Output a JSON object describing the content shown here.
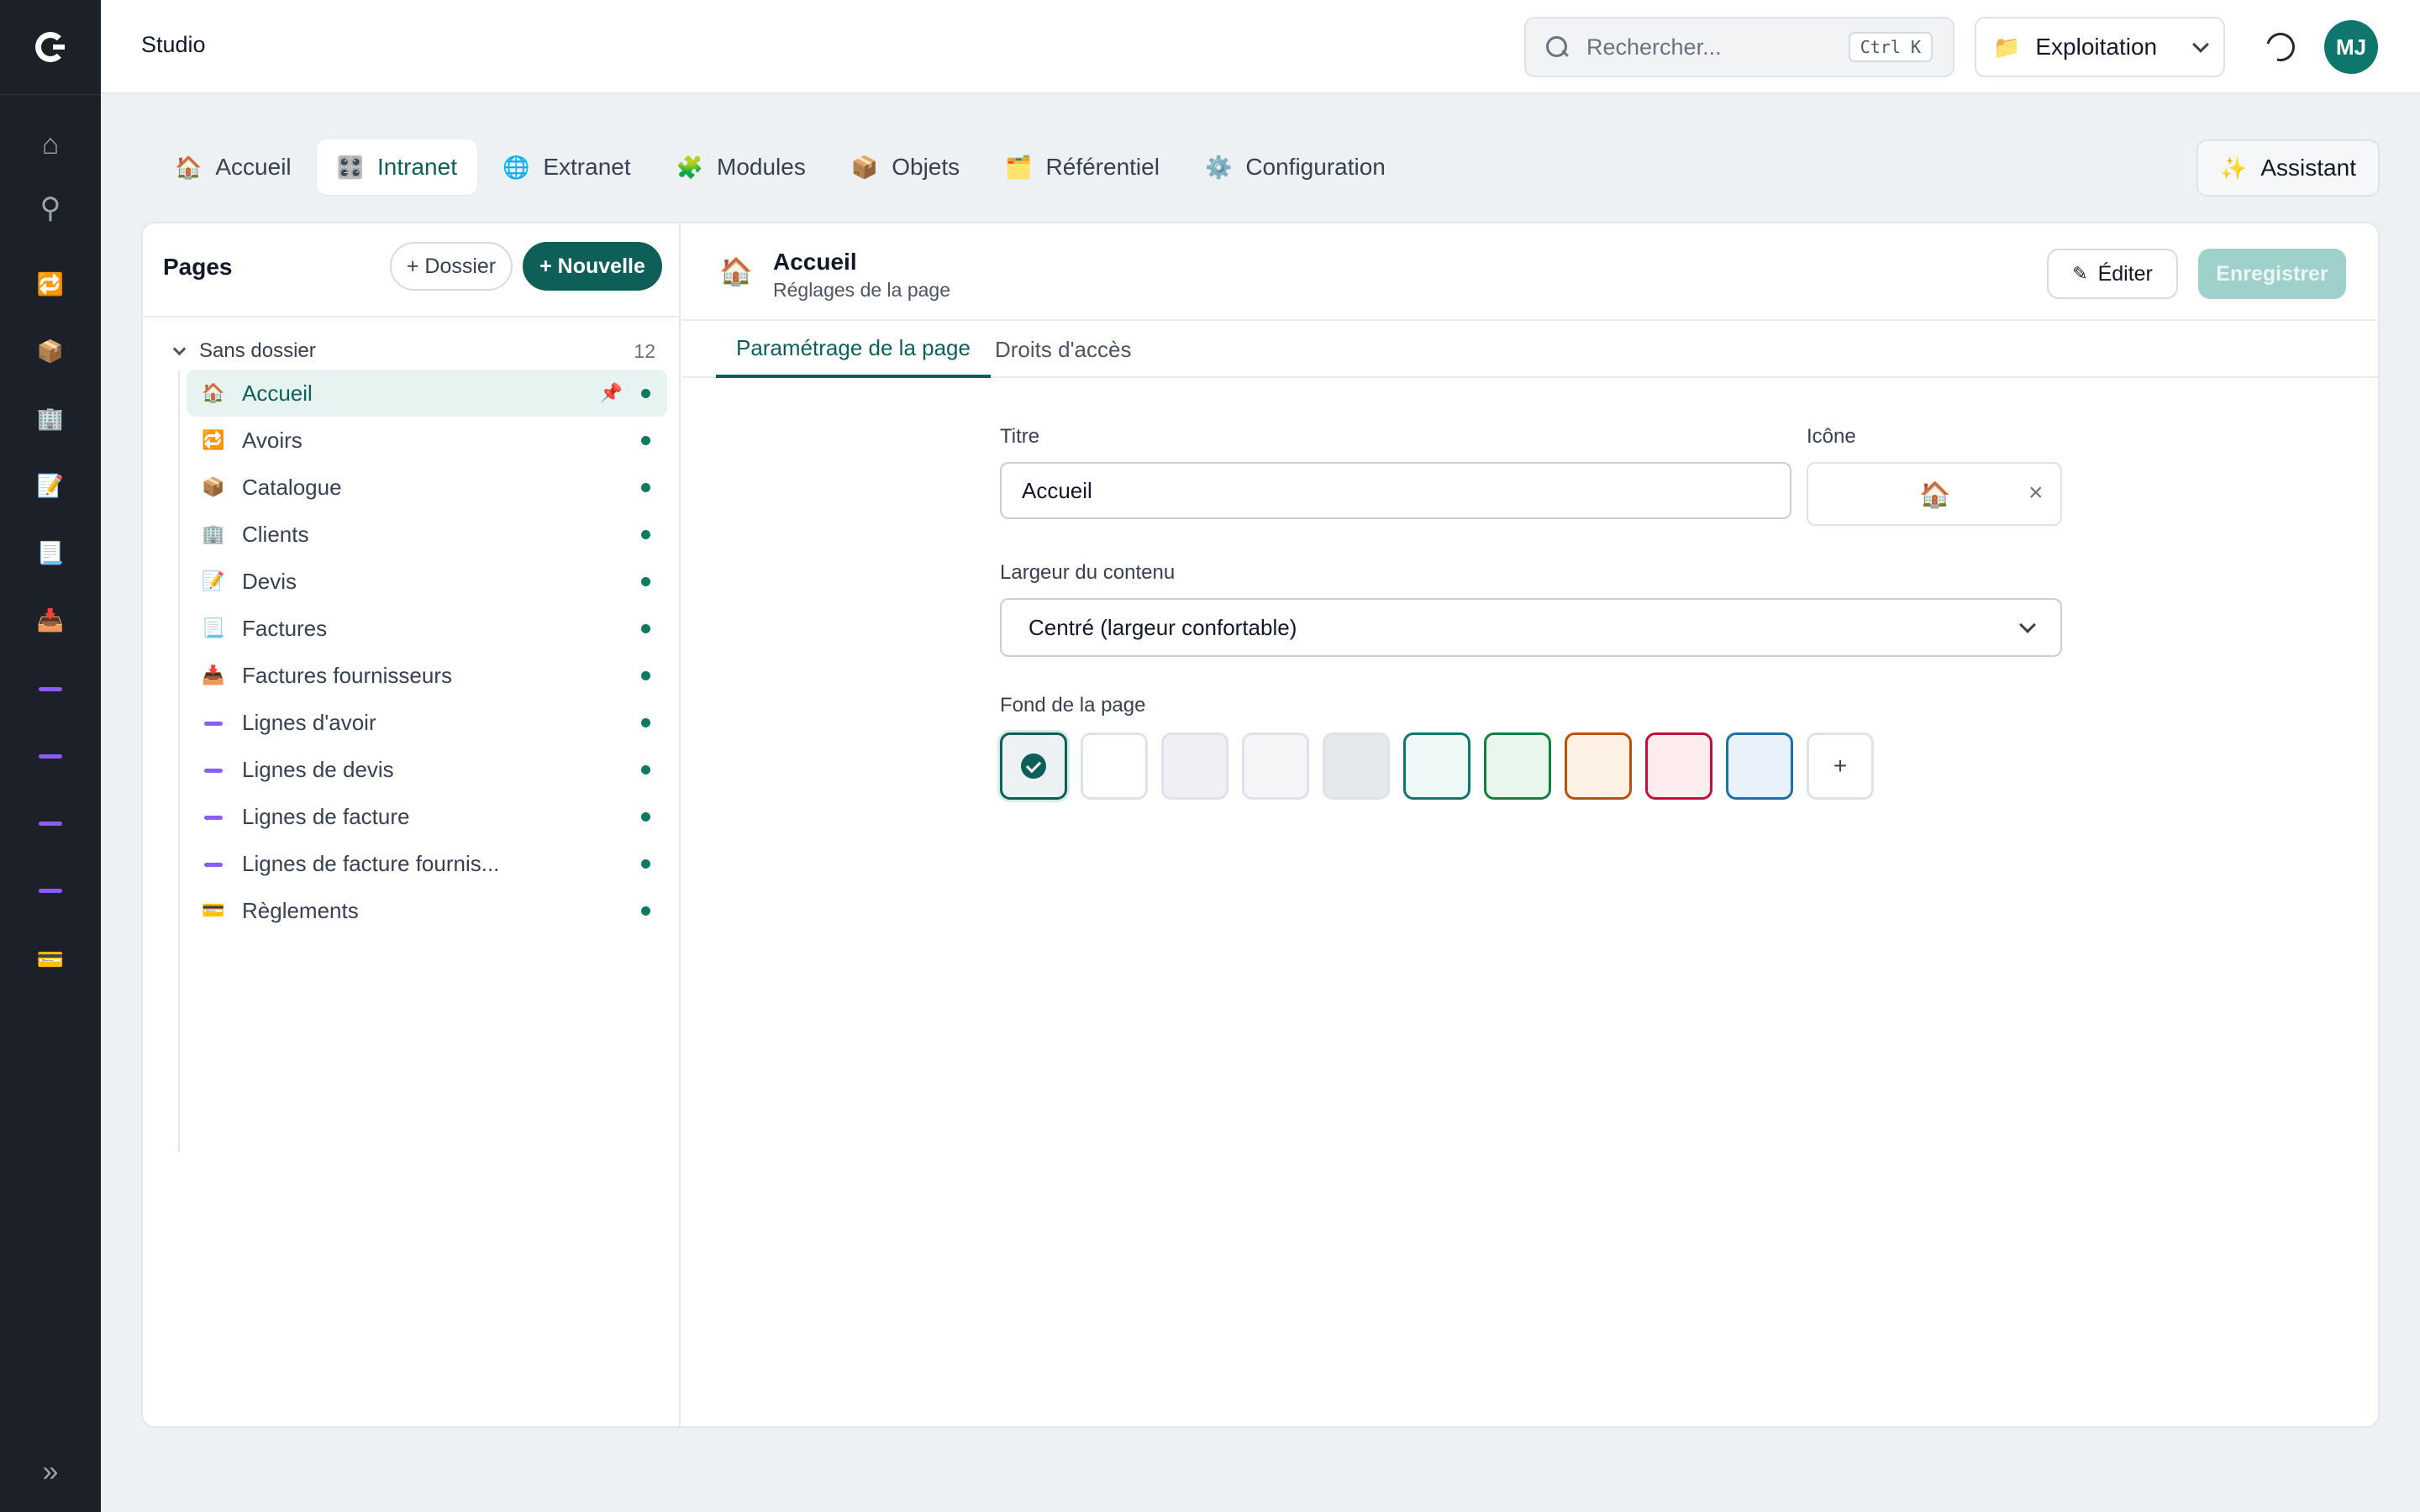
{
  "app": {
    "title": "Studio"
  },
  "rail": {
    "logo": "studio-logo",
    "items": [
      {
        "name": "home",
        "icon": "⌂"
      },
      {
        "name": "search",
        "icon": "⚲"
      },
      {
        "name": "avoirs",
        "icon": "🔁"
      },
      {
        "name": "catalogue",
        "icon": "📦"
      },
      {
        "name": "clients",
        "icon": "🏢"
      },
      {
        "name": "devis",
        "icon": "📝"
      },
      {
        "name": "factures",
        "icon": "📃"
      },
      {
        "name": "factures-fournisseurs",
        "icon": "📥"
      },
      {
        "name": "lignes-avoir",
        "icon": "line"
      },
      {
        "name": "lignes-devis",
        "icon": "line"
      },
      {
        "name": "lignes-facture",
        "icon": "line"
      },
      {
        "name": "lignes-facture-fournisseur",
        "icon": "line"
      },
      {
        "name": "reglements",
        "icon": "💳"
      }
    ],
    "expand_icon": "»"
  },
  "search": {
    "placeholder": "Rechercher...",
    "shortcut": "Ctrl K"
  },
  "workspace": {
    "emoji": "📁",
    "label": "Exploitation"
  },
  "user": {
    "initials": "MJ"
  },
  "module_tabs": [
    {
      "emoji": "🏠",
      "label": "Accueil"
    },
    {
      "emoji": "🎛️",
      "label": "Intranet",
      "active": true
    },
    {
      "emoji": "🌐",
      "label": "Extranet"
    },
    {
      "emoji": "🧩",
      "label": "Modules"
    },
    {
      "emoji": "📦",
      "label": "Objets"
    },
    {
      "emoji": "🗂️",
      "label": "Référentiel"
    },
    {
      "emoji": "⚙️",
      "label": "Configuration"
    }
  ],
  "assistant": {
    "emoji": "✨",
    "label": "Assistant"
  },
  "sidebar": {
    "title": "Pages",
    "folder_button": "+ Dossier",
    "new_button": "+ Nouvelle",
    "group": {
      "name": "Sans dossier",
      "count": "12"
    },
    "pages": [
      {
        "emoji": "🏠",
        "label": "Accueil",
        "active": true,
        "pinned": true
      },
      {
        "emoji": "🔁",
        "label": "Avoirs"
      },
      {
        "emoji": "📦",
        "label": "Catalogue"
      },
      {
        "emoji": "🏢",
        "label": "Clients"
      },
      {
        "emoji": "📝",
        "label": "Devis"
      },
      {
        "emoji": "📃",
        "label": "Factures"
      },
      {
        "emoji": "📥",
        "label": "Factures fournisseurs"
      },
      {
        "emoji": "line",
        "label": "Lignes d'avoir"
      },
      {
        "emoji": "line",
        "label": "Lignes de devis"
      },
      {
        "emoji": "line",
        "label": "Lignes de facture"
      },
      {
        "emoji": "line",
        "label": "Lignes de facture fournis..."
      },
      {
        "emoji": "💳",
        "label": "Règlements"
      }
    ]
  },
  "editor": {
    "emoji": "🏠",
    "title": "Accueil",
    "subtitle": "Réglages de la page",
    "edit_button": "Éditer",
    "save_button": "Enregistrer",
    "tabs": [
      {
        "label": "Paramétrage de la page",
        "active": true
      },
      {
        "label": "Droits d'accès"
      }
    ],
    "form": {
      "title_label": "Titre",
      "title_value": "Accueil",
      "icon_label": "Icône",
      "icon_value": "🏠",
      "width_label": "Largeur du contenu",
      "width_value": "Centré (largeur confortable)",
      "background_label": "Fond de la page",
      "add_swatch": "+",
      "swatches": [
        {
          "fill": "#eef1f4",
          "border": "#0f5f59",
          "selected": true
        },
        {
          "fill": "#ffffff",
          "border": "#dfe3e8"
        },
        {
          "fill": "#eef0f3",
          "border": "#dfe3e8"
        },
        {
          "fill": "#f3f5f7",
          "border": "#dfe3e8"
        },
        {
          "fill": "#e5e8ec",
          "border": "#dfe3e8"
        },
        {
          "fill": "#eef8f6",
          "border": "#0f766e"
        },
        {
          "fill": "#e8f6ee",
          "border": "#15803d"
        },
        {
          "fill": "#fdf1e3",
          "border": "#b45309"
        },
        {
          "fill": "#fdecee",
          "border": "#be123c"
        },
        {
          "fill": "#e9f1fb",
          "border": "#1d6fa5"
        }
      ]
    }
  },
  "colors": {
    "accent": "#0f5f59",
    "rail_bg": "#1c2129",
    "page_bg": "#eef1f4"
  }
}
